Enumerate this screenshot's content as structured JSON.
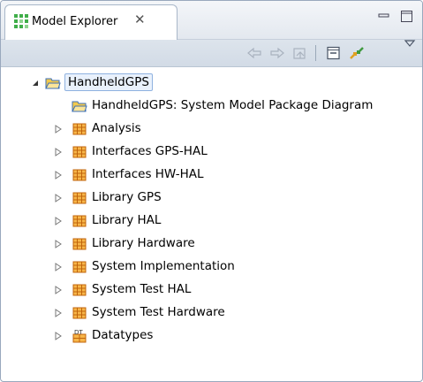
{
  "view": {
    "title": "Model Explorer",
    "close_glyph": "✕"
  },
  "toolbar": {
    "buttons": [
      {
        "name": "back-arrow-icon"
      },
      {
        "name": "forward-arrow-icon"
      },
      {
        "name": "home-icon"
      },
      {
        "name": "collapse-all-icon"
      },
      {
        "name": "link-with-editor-icon"
      },
      {
        "name": "view-menu-icon"
      }
    ]
  },
  "tree": {
    "root": {
      "label": "HandheldGPS",
      "expanded": true,
      "icon": "folder-icon"
    },
    "items": [
      {
        "label": "HandheldGPS: System Model Package Diagram",
        "icon": "diagram-folder-icon",
        "expandable": false
      },
      {
        "label": "Analysis",
        "icon": "package-icon",
        "expandable": true
      },
      {
        "label": "Interfaces GPS-HAL",
        "icon": "package-icon",
        "expandable": true
      },
      {
        "label": "Interfaces HW-HAL",
        "icon": "package-icon",
        "expandable": true
      },
      {
        "label": "Library GPS",
        "icon": "package-icon",
        "expandable": true
      },
      {
        "label": "Library HAL",
        "icon": "package-icon",
        "expandable": true
      },
      {
        "label": "Library Hardware",
        "icon": "package-icon",
        "expandable": true
      },
      {
        "label": "System Implementation",
        "icon": "package-icon",
        "expandable": true
      },
      {
        "label": "System Test HAL",
        "icon": "package-icon",
        "expandable": true
      },
      {
        "label": "System Test Hardware",
        "icon": "package-icon",
        "expandable": true
      },
      {
        "label": "Datatypes",
        "icon": "datatypes-icon",
        "expandable": true
      }
    ]
  },
  "colors": {
    "package": "#e07a10",
    "folder": "#f2c94c",
    "accent": "#3d6fb6"
  }
}
